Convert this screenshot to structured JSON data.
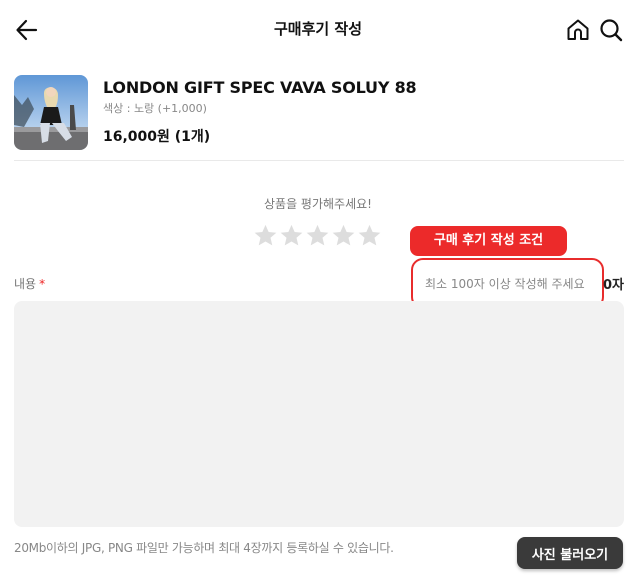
{
  "header": {
    "title": "구매후기 작성",
    "icons": [
      "back-arrow-icon",
      "home-icon",
      "search-icon"
    ]
  },
  "product": {
    "name": "LONDON GIFT SPEC VAVA SOLUY 88",
    "option": "색상 : 노랑 (+1,000)",
    "price": "16,000원 (1개)"
  },
  "rating": {
    "prompt": "상품을 평가해주세요!",
    "max_stars": 5,
    "selected": 0,
    "star_color": "#dddddd"
  },
  "annotation": {
    "callout_label": "구매 후기 작성 조건",
    "accent_color": "#ec2a2a"
  },
  "review": {
    "label": "내용",
    "required_mark": "*",
    "placeholder": "최소 100자 이상 작성해 주세요",
    "char_count": "0자"
  },
  "upload": {
    "hint": "20Mb이하의 JPG, PNG 파일만 가능하며 최대 4장까지 등록하실 수 있습니다.",
    "button_label": "사진 불러오기"
  }
}
